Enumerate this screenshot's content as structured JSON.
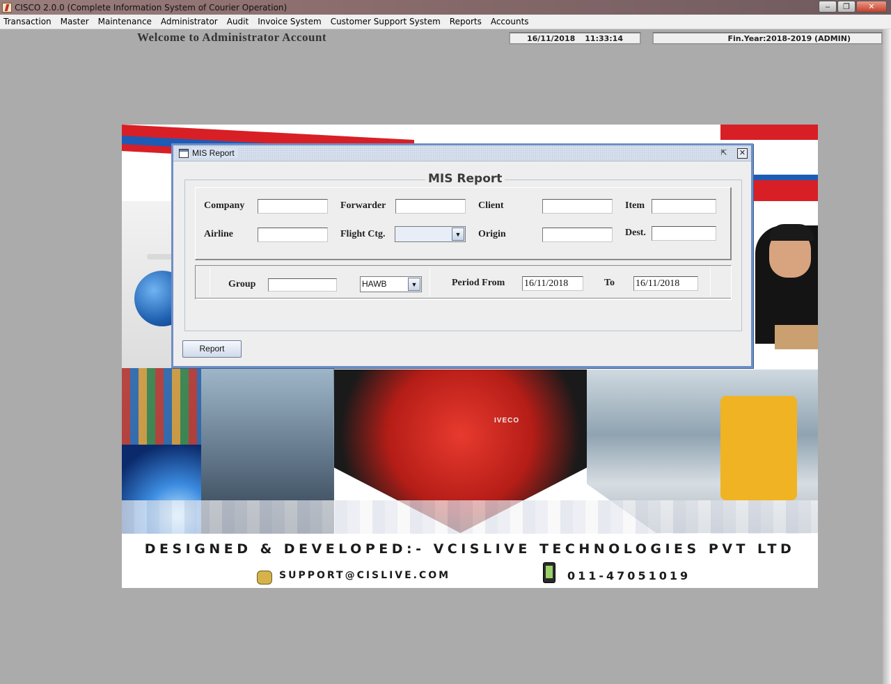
{
  "window": {
    "title": "CISCO 2.0.0 (Complete Information System of Courier Operation)",
    "controls": {
      "minimize_icon": "minimize-icon",
      "maximize_icon": "restore-icon",
      "close_icon": "close-icon"
    }
  },
  "menu": {
    "items": [
      {
        "label": "Transaction"
      },
      {
        "label": "Master"
      },
      {
        "label": "Maintenance"
      },
      {
        "label": "Administrator"
      },
      {
        "label": "Audit"
      },
      {
        "label": "Invoice System"
      },
      {
        "label": "Customer Support System"
      },
      {
        "label": "Reports"
      },
      {
        "label": "Accounts"
      }
    ]
  },
  "header": {
    "welcome": "Welcome to Administrator Account",
    "date": "16/11/2018",
    "time": "11:33:14",
    "fin_year": "Fin.Year:2018-2019  (ADMIN)"
  },
  "poster": {
    "designed_by": "DESIGNED & DEVELOPED:- VCISLIVE TECHNOLOGIES PVT LTD",
    "email": "SUPPORT@CISLIVE.COM",
    "phone": "011-47051019",
    "truck_text": "IVECO"
  },
  "mis_report": {
    "frame_title": "MIS Report",
    "heading": "MIS Report",
    "fields": {
      "company": {
        "label": "Company",
        "value": ""
      },
      "forwarder": {
        "label": "Forwarder",
        "value": ""
      },
      "client": {
        "label": "Client",
        "value": ""
      },
      "item": {
        "label": "Item",
        "value": ""
      },
      "airline": {
        "label": "Airline",
        "value": ""
      },
      "flight_ctg": {
        "label": "Flight Ctg.",
        "value": ""
      },
      "origin": {
        "label": "Origin",
        "value": ""
      },
      "dest": {
        "label": "Dest.",
        "value": ""
      },
      "group": {
        "label": "Group",
        "value": ""
      },
      "type": {
        "value": "HAWB"
      },
      "period_from": {
        "label": "Period From",
        "value": "16/11/2018"
      },
      "to": {
        "label": "To",
        "value": "16/11/2018"
      }
    },
    "report_button": "Report"
  },
  "colors": {
    "frame_border": "#6e8fc6",
    "desktop": "#ababab",
    "accent_red": "#d81f26",
    "accent_blue": "#1e5bb5"
  }
}
